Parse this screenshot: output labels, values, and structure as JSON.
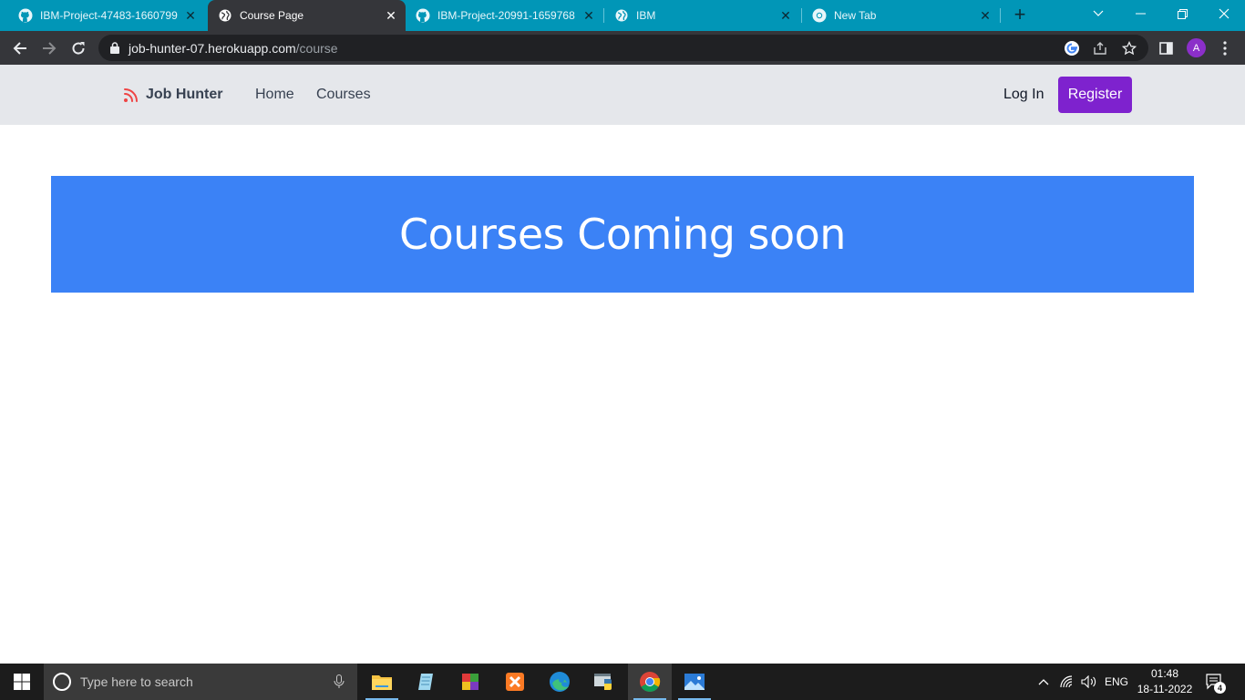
{
  "browser": {
    "tabs": [
      {
        "title": "IBM-Project-47483-1660799",
        "icon": "github-icon",
        "active": false
      },
      {
        "title": "Course Page",
        "icon": "globe-icon",
        "active": true
      },
      {
        "title": "IBM-Project-20991-1659768",
        "icon": "github-icon",
        "active": false
      },
      {
        "title": "IBM",
        "icon": "globe-icon",
        "active": false
      },
      {
        "title": "New Tab",
        "icon": "chrome-icon",
        "active": false
      }
    ],
    "address": {
      "host": "job-hunter-07.herokuapp.com",
      "path": "/course"
    },
    "profile_initial": "A"
  },
  "site": {
    "brand": "Job Hunter",
    "nav_home": "Home",
    "nav_courses": "Courses",
    "login": "Log In",
    "register": "Register",
    "banner_text": "Courses Coming soon",
    "colors": {
      "nav_bg": "#e5e7eb",
      "banner_bg": "#3b82f6",
      "register_bg": "#7e22ce"
    }
  },
  "taskbar": {
    "search_placeholder": "Type here to search",
    "language": "ENG",
    "time": "01:48",
    "date": "18-11-2022",
    "notification_count": "4"
  }
}
